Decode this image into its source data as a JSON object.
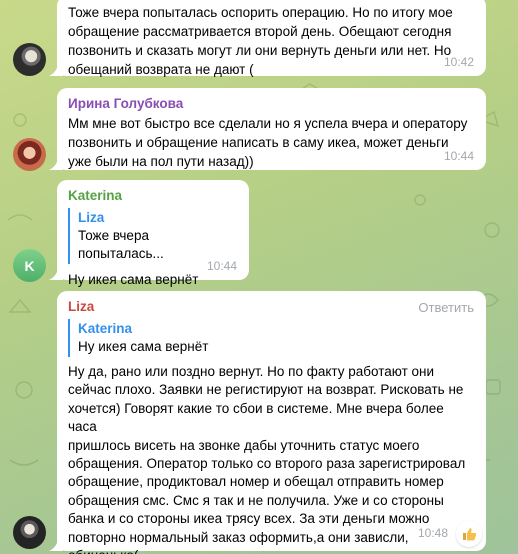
{
  "messages": [
    {
      "text": "Тоже вчера попыталась оспорить операцию. Но по итогу мое\nобращение рассматривается второй день. Обещают сегодня\nпозвонить и сказать могут ли они вернуть деньги или нет. Но\nобещаний возврата не дают (",
      "time": "10:42"
    },
    {
      "sender": "Ирина Голубкова",
      "text": "Мм мне вот быстро все сделали но я успела вчера и оператору\nпозвонить и обращение написать в саму икеа, может деньги\nуже были на пол пути назад))",
      "time": "10:44"
    },
    {
      "sender": "Katerina",
      "avatar_letter": "K",
      "quote": {
        "name": "Liza",
        "text": "Тоже вчера попыталась..."
      },
      "text": "Ну икея сама вернёт",
      "time": "10:44"
    },
    {
      "sender": "Liza",
      "reply_label": "Ответить",
      "quote": {
        "name": "Katerina",
        "text": "Ну икея сама вернёт"
      },
      "text": "Ну да, рано или поздно вернут. Но по факту работают они\nсейчас плохо. Заявки не регистируют на возврат. Рисковать не\nхочется) Говорят какие то сбои в системе. Мне вчера более часа\nпришлось висеть на звонке дабы уточнить статус моего\nобращения. Оператор только со второго раза зарегистрировал\nобращение, продиктовал номер и обещал отправить номер\nобращения смс. Смс я так и не получила. Уже и со стороны\nбанка и со стороны икеа трясу всех. За эти деньги можно\nповторно нормальный заказ оформить,а они зависли,\nобиненько(",
      "time": "10:48",
      "reaction_icon": "thumbs-up-icon"
    }
  ],
  "colors": {
    "sender_irina": "#8a4db3",
    "sender_katerina": "#55a245",
    "sender_liza": "#c9483f",
    "quote_accent": "#3390ec"
  }
}
